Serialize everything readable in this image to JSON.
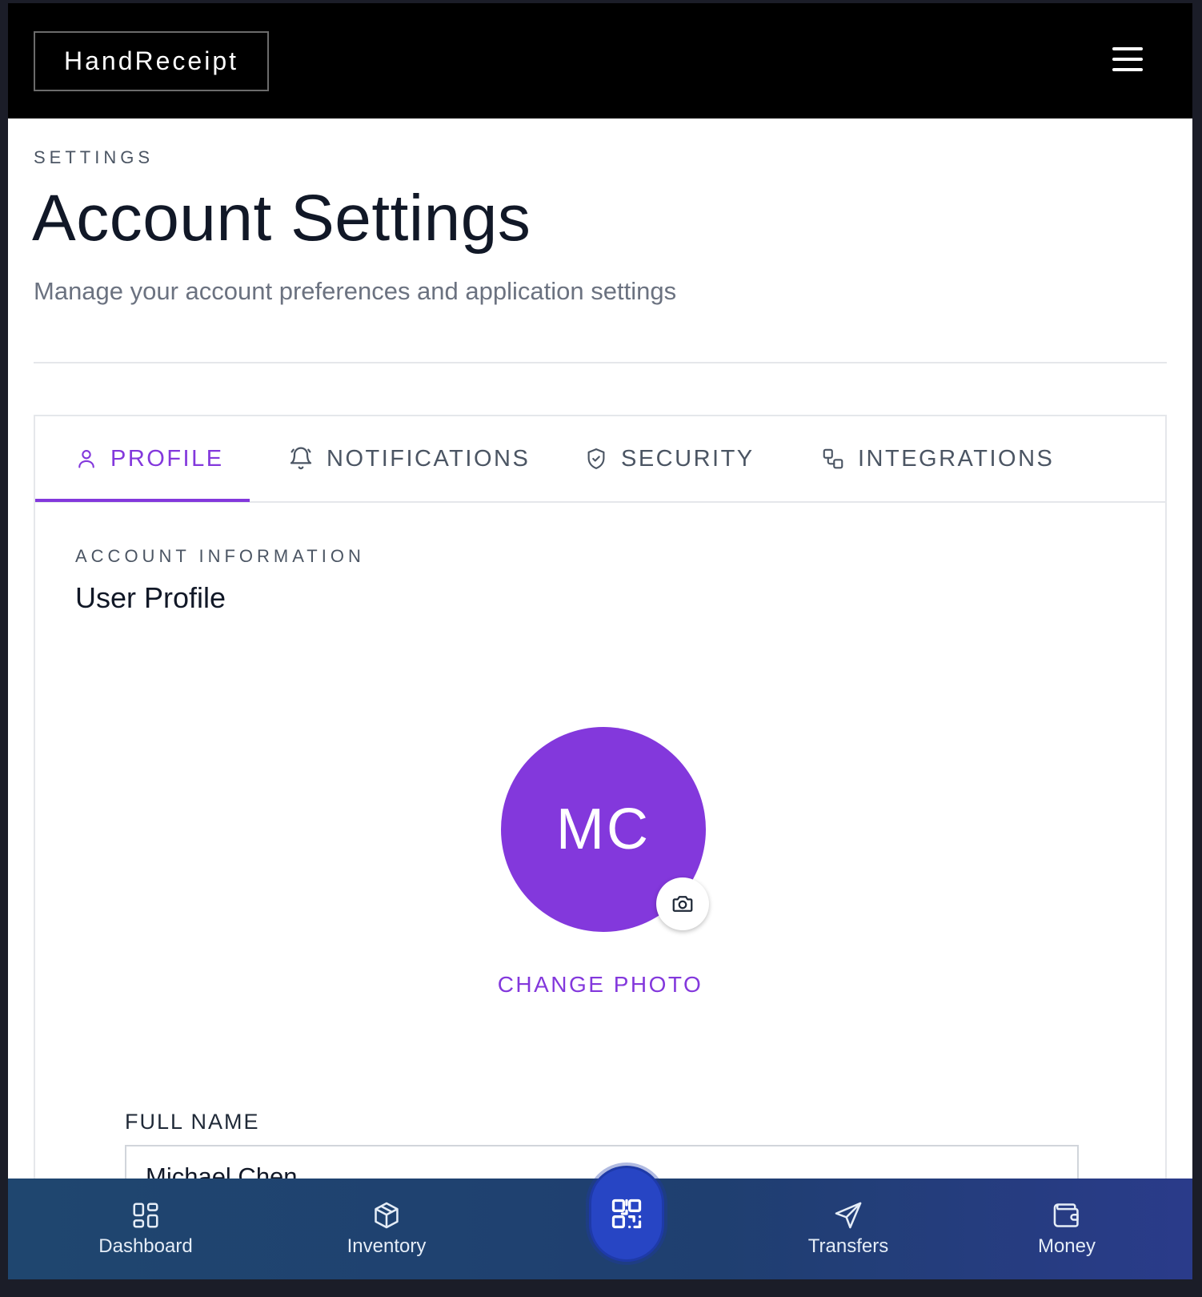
{
  "app": {
    "name": "HandReceipt"
  },
  "header": {
    "eyebrow": "SETTINGS",
    "title": "Account Settings",
    "subtitle": "Manage your account preferences and application settings"
  },
  "tabs": [
    {
      "label": "PROFILE",
      "icon": "user-icon",
      "active": true
    },
    {
      "label": "NOTIFICATIONS",
      "icon": "bell-icon",
      "active": false
    },
    {
      "label": "SECURITY",
      "icon": "shield-icon",
      "active": false
    },
    {
      "label": "INTEGRATIONS",
      "icon": "integrations-icon",
      "active": false
    }
  ],
  "profile": {
    "section_eyebrow": "ACCOUNT INFORMATION",
    "section_title": "User Profile",
    "avatar_initials": "MC",
    "change_photo_label": "CHANGE PHOTO",
    "full_name_label": "FULL NAME",
    "full_name_value": "Michael Chen"
  },
  "bottom_nav": [
    {
      "label": "Dashboard",
      "icon": "dashboard-icon"
    },
    {
      "label": "Inventory",
      "icon": "box-icon"
    },
    {
      "label": "",
      "icon": "qr-code-icon"
    },
    {
      "label": "Transfers",
      "icon": "send-icon"
    },
    {
      "label": "Money",
      "icon": "wallet-icon"
    }
  ],
  "colors": {
    "accent": "#8338dc",
    "topbar": "#000000",
    "bottom_nav": "#1f466f",
    "scan_button": "#2745c4"
  }
}
